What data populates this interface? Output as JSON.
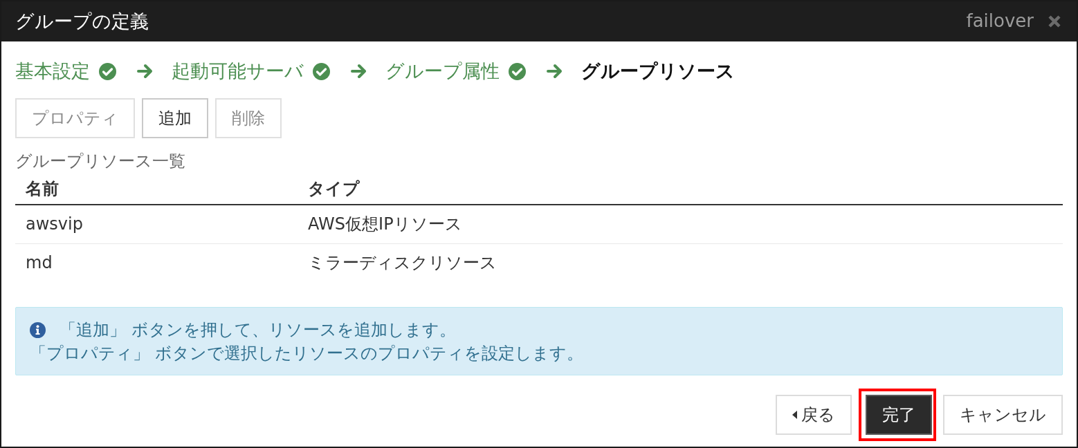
{
  "window": {
    "title": "グループの定義",
    "context": "failover"
  },
  "steps": [
    {
      "label": "基本設定",
      "done": true,
      "current": false
    },
    {
      "label": "起動可能サーバ",
      "done": true,
      "current": false
    },
    {
      "label": "グループ属性",
      "done": true,
      "current": false
    },
    {
      "label": "グループリソース",
      "done": false,
      "current": true
    }
  ],
  "toolbar": [
    {
      "label": "プロパティ",
      "disabled": true
    },
    {
      "label": "追加",
      "disabled": false
    },
    {
      "label": "削除",
      "disabled": true
    }
  ],
  "list_title": "グループリソース一覧",
  "table": {
    "columns": [
      "名前",
      "タイプ"
    ],
    "rows": [
      {
        "cells": [
          "awsvip",
          "AWS仮想IPリソース"
        ],
        "selected": false
      },
      {
        "cells": [
          "md",
          "ミラーディスクリソース"
        ],
        "selected": false
      }
    ]
  },
  "info": {
    "lines": [
      "「追加」 ボタンを押して、リソースを追加します。",
      "「プロパティ」 ボタンで選択したリソースのプロパティを設定します。"
    ]
  },
  "footer_buttons": [
    {
      "kind": "back",
      "label": "戻る",
      "highlighted": false
    },
    {
      "kind": "primary",
      "label": "完了",
      "highlighted": true
    },
    {
      "kind": "cancel",
      "label": "キャンセル",
      "highlighted": false
    }
  ]
}
